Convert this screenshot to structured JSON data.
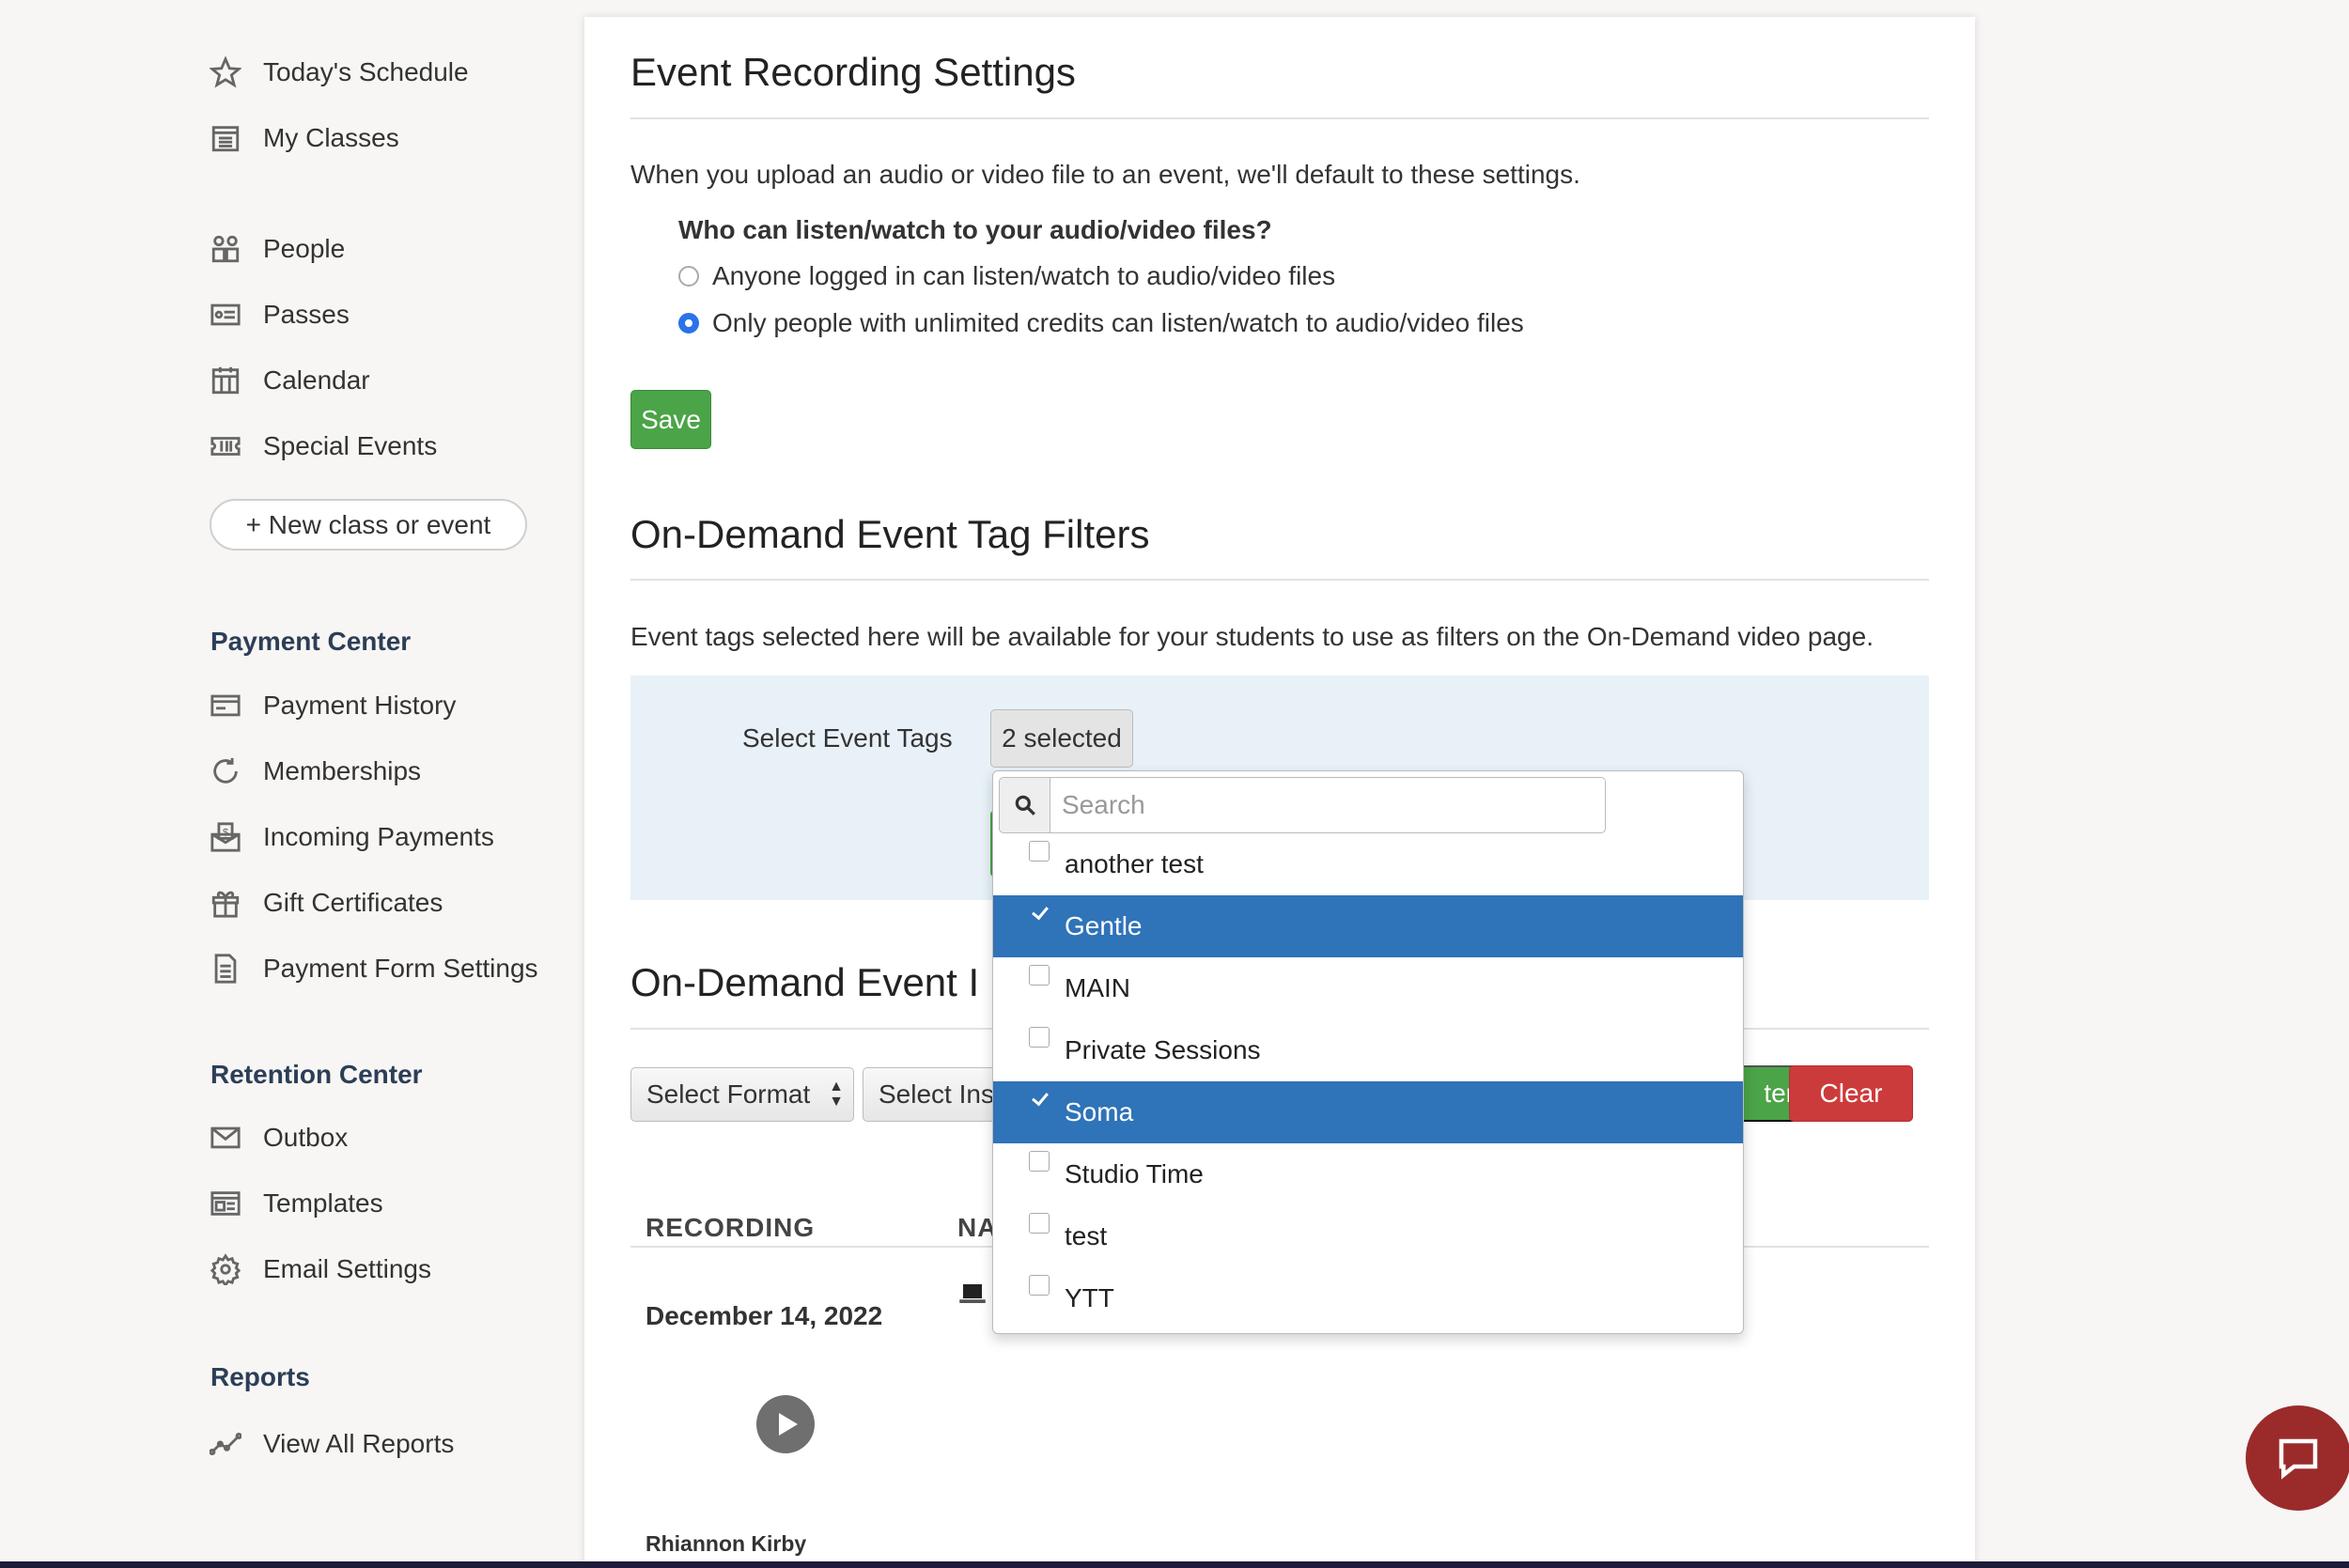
{
  "sidebar": {
    "top_items": [
      {
        "label": "Today's Schedule",
        "icon": "star-icon"
      },
      {
        "label": "My Classes",
        "icon": "calendar-list-icon"
      }
    ],
    "mid_items": [
      {
        "label": "People",
        "icon": "people-icon"
      },
      {
        "label": "Passes",
        "icon": "pass-card-icon"
      },
      {
        "label": "Calendar",
        "icon": "calendar-icon"
      },
      {
        "label": "Special Events",
        "icon": "ticket-icon"
      }
    ],
    "new_button": "+ New class or event",
    "payment_center": {
      "title": "Payment Center",
      "items": [
        {
          "label": "Payment History",
          "icon": "credit-card-icon"
        },
        {
          "label": "Memberships",
          "icon": "refresh-icon"
        },
        {
          "label": "Incoming Payments",
          "icon": "money-envelope-icon"
        },
        {
          "label": "Gift Certificates",
          "icon": "gift-icon"
        },
        {
          "label": "Payment Form Settings",
          "icon": "form-icon"
        }
      ]
    },
    "retention_center": {
      "title": "Retention Center",
      "items": [
        {
          "label": "Outbox",
          "icon": "envelope-icon"
        },
        {
          "label": "Templates",
          "icon": "template-icon"
        },
        {
          "label": "Email Settings",
          "icon": "gear-icon"
        }
      ]
    },
    "reports": {
      "title": "Reports",
      "items": [
        {
          "label": "View All Reports",
          "icon": "line-chart-icon"
        }
      ]
    }
  },
  "recording": {
    "title": "Event Recording Settings",
    "description": "When you upload an audio or video file to an event, we'll default to these settings.",
    "question": "Who can listen/watch to your audio/video files?",
    "options": [
      {
        "label": "Anyone logged in can listen/watch to audio/video files",
        "checked": false
      },
      {
        "label": "Only people with unlimited credits can listen/watch to audio/video files",
        "checked": true
      }
    ],
    "save_label": "Save"
  },
  "tag_filters": {
    "title": "On-Demand Event Tag Filters",
    "description": "Event tags selected here will be available for your students to use as filters on the On-Demand video page.",
    "select_label": "Select Event Tags",
    "selected_text": "2 selected"
  },
  "dropdown": {
    "search_placeholder": "Search",
    "options": [
      {
        "label": "another test",
        "selected": false
      },
      {
        "label": "Gentle",
        "selected": true
      },
      {
        "label": "MAIN",
        "selected": false
      },
      {
        "label": "Private Sessions",
        "selected": false
      },
      {
        "label": "Soma",
        "selected": true
      },
      {
        "label": "Studio Time",
        "selected": false
      },
      {
        "label": "test",
        "selected": false
      },
      {
        "label": "YTT",
        "selected": false
      }
    ]
  },
  "events": {
    "title_visible": "On-Demand Event I",
    "format_select": "Select Format",
    "instructor_select": "Select Ins",
    "filter_label_visible": "ter",
    "clear_label": "Clear",
    "columns": [
      "RECORDING",
      "NA"
    ],
    "row": {
      "date": "December 14, 2022",
      "instructor": "Rhiannon Kirby"
    }
  },
  "colors": {
    "accent_blue": "#2f73b8",
    "save_green": "#4ba447",
    "clear_red": "#cc3b3b",
    "chat_red": "#9b2b2b"
  }
}
